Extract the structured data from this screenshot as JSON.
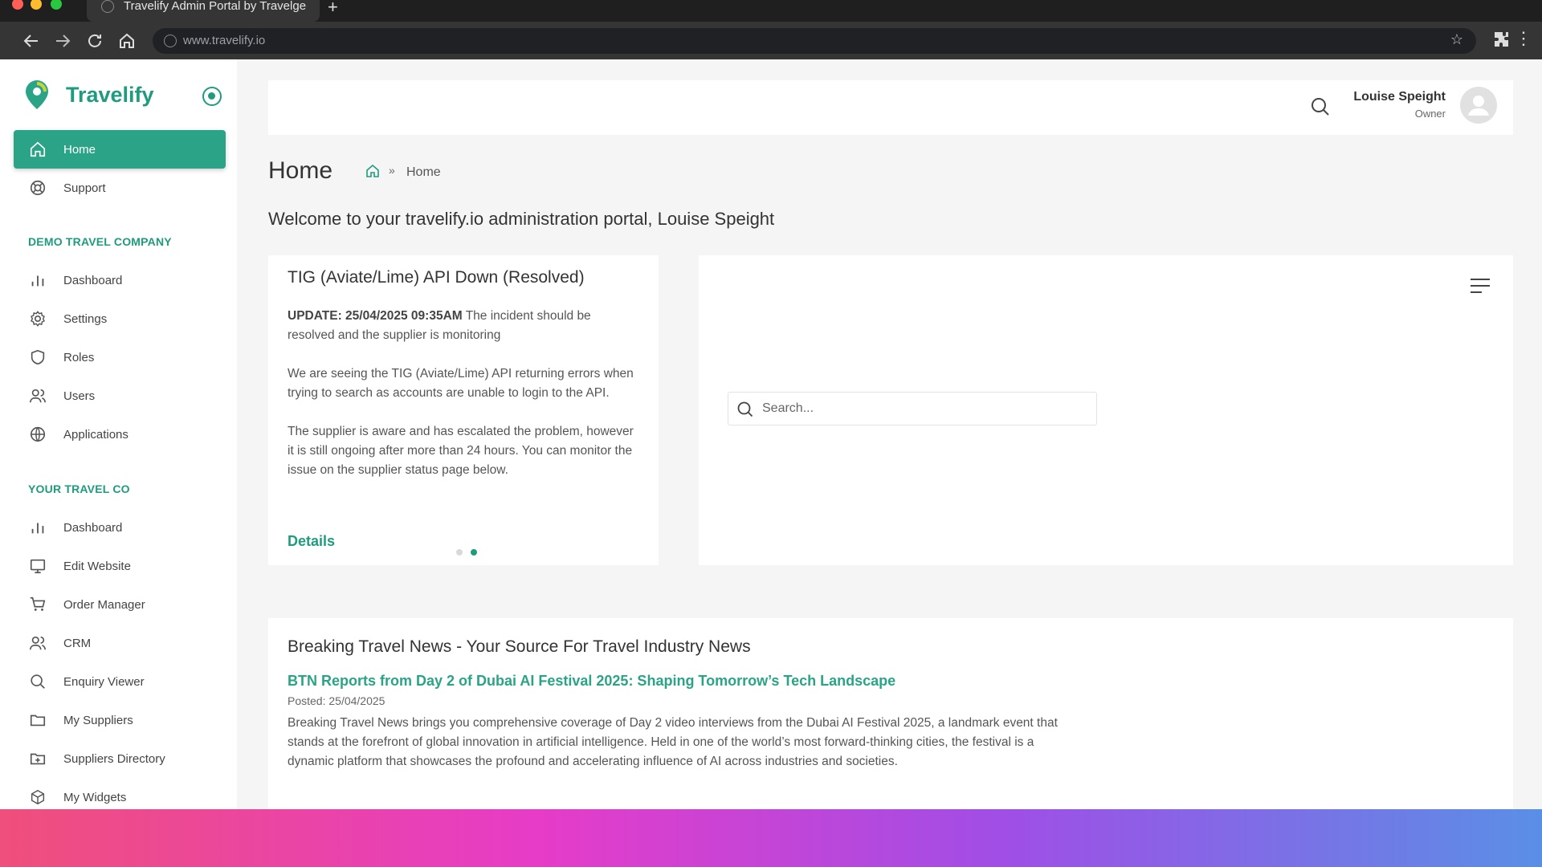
{
  "browser": {
    "tab_title": "Travelify Admin Portal by Travelge",
    "url": "www.travelify.io"
  },
  "sidebar": {
    "logo_text": "Travelify",
    "top_items": [
      {
        "label": "Home",
        "icon": "home-icon",
        "active": true
      },
      {
        "label": "Support",
        "icon": "lifebuoy-icon"
      }
    ],
    "section1": {
      "title": "DEMO TRAVEL COMPANY",
      "items": [
        {
          "label": "Dashboard",
          "icon": "bar-chart-icon"
        },
        {
          "label": "Settings",
          "icon": "gear-icon"
        },
        {
          "label": "Roles",
          "icon": "shield-icon"
        },
        {
          "label": "Users",
          "icon": "users-icon"
        },
        {
          "label": "Applications",
          "icon": "globe-icon"
        }
      ]
    },
    "section2": {
      "title": "YOUR TRAVEL CO",
      "items": [
        {
          "label": "Dashboard",
          "icon": "bar-chart-icon"
        },
        {
          "label": "Edit Website",
          "icon": "monitor-icon"
        },
        {
          "label": "Order Manager",
          "icon": "cart-icon"
        },
        {
          "label": "CRM",
          "icon": "users-icon"
        },
        {
          "label": "Enquiry Viewer",
          "icon": "search-icon"
        },
        {
          "label": "My Suppliers",
          "icon": "folder-icon"
        },
        {
          "label": "Suppliers Directory",
          "icon": "folder-plus-icon"
        },
        {
          "label": "My Widgets",
          "icon": "cube-icon"
        }
      ]
    }
  },
  "header": {
    "user_name": "Louise Speight",
    "user_role": "Owner"
  },
  "page": {
    "title": "Home",
    "breadcrumb_current": "Home",
    "welcome": "Welcome to your travelify.io administration portal, Louise Speight"
  },
  "alert": {
    "title": "TIG (Aviate/Lime) API Down (Resolved)",
    "update_label": "UPDATE: 25/04/2025 09:35AM",
    "update_text": " The incident should be resolved and the supplier is monitoring",
    "para2": "We are seeing the TIG (Aviate/Lime) API returning errors when trying to search as accounts are unable to login to the API.",
    "para3": "The supplier is aware and has escalated the problem, however it is still ongoing after more than 24 hours. You can monitor the issue on the supplier status page below.",
    "details_label": "Details"
  },
  "search": {
    "placeholder": "Search..."
  },
  "news": {
    "heading": "Breaking Travel News - Your Source For Travel Industry News",
    "article_title": "BTN Reports from Day 2 of Dubai AI Festival 2025: Shaping Tomorrow’s Tech Landscape",
    "posted": "Posted: 25/04/2025",
    "body": "Breaking Travel News brings you comprehensive coverage of Day 2 video interviews from the Dubai AI Festival 2025, a landmark event that stands at the forefront of global innovation in artificial intelligence. Held in one of the world’s most forward-thinking cities, the festival is a dynamic platform that showcases the profound and accelerating influence of AI across industries and societies."
  },
  "colors": {
    "accent": "#1f9b7d",
    "active_nav": "#2aa386"
  }
}
